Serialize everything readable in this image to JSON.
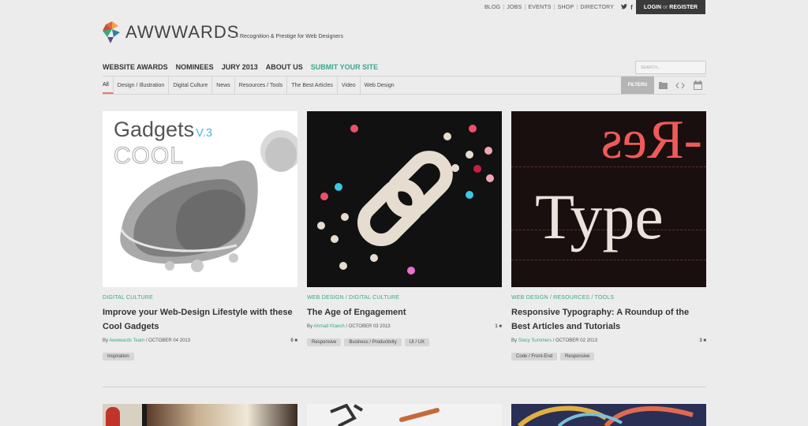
{
  "util": {
    "links": [
      "BLOG",
      "JOBS",
      "EVENTS",
      "SHOP",
      "DIRECTORY"
    ],
    "login": "LOGIN",
    "or": "or",
    "register": "REGISTER"
  },
  "logo": {
    "text": "AWWWARDS",
    "tagline": "Recognition & Prestige for Web Designers"
  },
  "nav": {
    "items": [
      "WEBSITE AWARDS",
      "NOMINEES",
      "JURY 2013",
      "ABOUT US"
    ],
    "submit": "SUBMIT YOUR SITE"
  },
  "search": {
    "placeholder": "SEARCH..."
  },
  "subnav": {
    "items": [
      "All",
      "Design / Illustration",
      "Digital Culture",
      "News",
      "Resources / Tools",
      "The Best Articles",
      "Video",
      "Web Design"
    ],
    "filters": "FILTERS"
  },
  "colors": {
    "accent": "#38a88c",
    "active_underline": "#e57b65"
  },
  "cards": [
    {
      "category": "DIGITAL CULTURE",
      "title": "Improve your Web-Design Lifestyle with these Cool Gadgets",
      "by": "By",
      "author": "Awwwards Team",
      "date": "/ OCTOBER 04 2013",
      "comments": "0",
      "tags": [
        "Inspiration"
      ],
      "img_text1": "Gadgets",
      "img_text2": "V.3",
      "img_text3": "COOL"
    },
    {
      "category": "WEB DESIGN / DIGITAL CULTURE",
      "title": "The Age of Engagement",
      "by": "By",
      "author": "Ahmad Ktaech",
      "date": "/ OCTOBER 03 2013",
      "comments": "1",
      "tags": [
        "Responsive",
        "Business / Productivity",
        "UI / UX"
      ]
    },
    {
      "category": "WEB DESIGN / RESOURCES / TOOLS",
      "title": "Responsive Typography: A Roundup of the Best Articles and Tutorials",
      "by": "By",
      "author": "Stacy Summers",
      "date": "/ OCTOBER 02 2013",
      "comments": "3",
      "tags": [
        "Code / Front-End",
        "Responsive"
      ],
      "img_text1": "-Res",
      "img_text2": "Type"
    }
  ]
}
